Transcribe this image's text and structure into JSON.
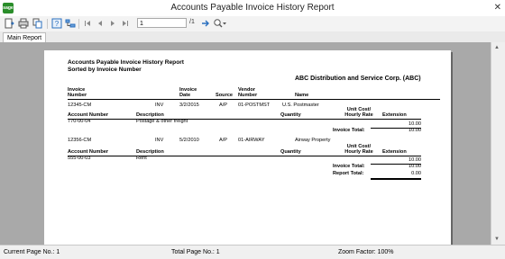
{
  "window": {
    "title": "Accounts Payable Invoice History Report",
    "app_icon_text": "sage",
    "close_glyph": "✕"
  },
  "toolbar": {
    "page_value": "1",
    "page_total": "/1"
  },
  "tabs": [
    {
      "label": "Main Report"
    }
  ],
  "report": {
    "title": "Accounts Payable Invoice History Report",
    "subtitle": "Sorted by Invoice Number",
    "company": "ABC Distribution and Service Corp. (ABC)",
    "headers": {
      "invoice": "Invoice",
      "number": "Number",
      "invoice2": "Invoice",
      "date": "Date",
      "source": "Source",
      "vendor": "Vendor",
      "vnumber": "Number",
      "name": "Name"
    },
    "detail_headers": {
      "account_number": "Account Number",
      "description": "Description",
      "quantity": "Quantity",
      "unit_cost": "Unit Cost/",
      "hourly_rate": "Hourly Rate",
      "extension": "Extension"
    },
    "invoices": [
      {
        "number": "12345-CM",
        "type": "INV",
        "date": "3/2/2015",
        "source": "A/P",
        "vendor": "01-POSTMST",
        "name": "U.S. Postmaster",
        "line_account": "770-00-04",
        "line_description": "Postage & other freight",
        "line_extension": "10.00",
        "total_label": "Invoice Total:",
        "total_value": "10.00"
      },
      {
        "number": "12356-CM",
        "type": "INV",
        "date": "5/2/2010",
        "source": "A/P",
        "vendor": "01-AIRWAY",
        "name": "Airway Property",
        "line_account": "555-00-03",
        "line_description": "Rent",
        "line_extension": "10.00",
        "total_label": "Invoice Total:",
        "total_value": "10.00"
      }
    ],
    "report_total_label": "Report Total:",
    "report_total_value": "0.00"
  },
  "status": {
    "current_page": "Current Page No.: 1",
    "total_page": "Total Page No.: 1",
    "zoom": "Zoom Factor: 100%"
  }
}
